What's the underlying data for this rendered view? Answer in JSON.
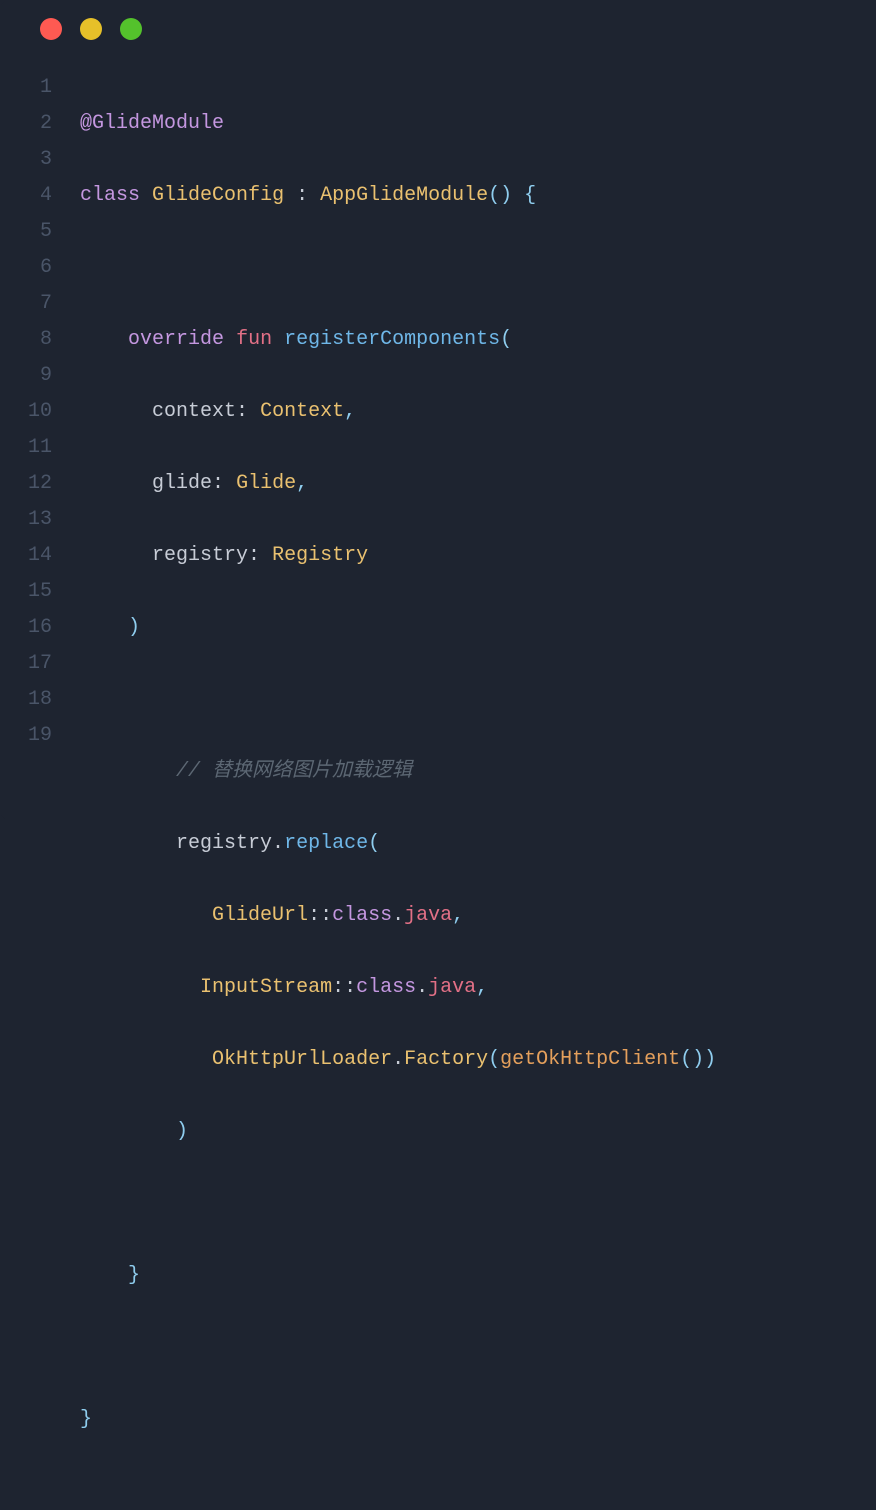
{
  "titleBar": {
    "buttons": [
      "close",
      "minimize",
      "maximize"
    ]
  },
  "lineNumbers": [
    "1",
    "2",
    "3",
    "4",
    "5",
    "6",
    "7",
    "8",
    "9",
    "10",
    "11",
    "12",
    "13",
    "14",
    "15",
    "16",
    "17",
    "18",
    "19"
  ],
  "code": {
    "l1_annotation": "@GlideModule",
    "l2_class": "class",
    "l2_name": "GlideConfig",
    "l2_colon": " : ",
    "l2_parent": "AppGlideModule",
    "l2_parens": "()",
    "l2_brace": " {",
    "l4_indent": "    ",
    "l4_override": "override",
    "l4_sp": " ",
    "l4_fun": "fun",
    "l4_sp2": " ",
    "l4_method": "registerComponents",
    "l4_open": "(",
    "l5_indent": "      ",
    "l5_param": "context",
    "l5_colon": ": ",
    "l5_type": "Context",
    "l5_comma": ",",
    "l6_indent": "      ",
    "l6_param": "glide",
    "l6_colon": ": ",
    "l6_type": "Glide",
    "l6_comma": ",",
    "l7_indent": "      ",
    "l7_param": "registry",
    "l7_colon": ": ",
    "l7_type": "Registry",
    "l8_indent": "    ",
    "l8_close": ")",
    "l10_indent": "        ",
    "l10_comment": "// 替换网络图片加载逻辑",
    "l11_indent": "        ",
    "l11_obj": "registry",
    "l11_dot": ".",
    "l11_method": "replace",
    "l11_open": "(",
    "l12_indent": "           ",
    "l12_cls": "GlideUrl",
    "l12_cc": "::",
    "l12_class": "class",
    "l12_dot": ".",
    "l12_java": "java",
    "l12_comma": ",",
    "l13_indent": "          ",
    "l13_cls": "InputStream",
    "l13_cc": "::",
    "l13_class": "class",
    "l13_dot": ".",
    "l13_java": "java",
    "l13_comma": ",",
    "l14_indent": "           ",
    "l14_cls": "OkHttpUrlLoader",
    "l14_dot": ".",
    "l14_factory": "Factory",
    "l14_open": "(",
    "l14_fn": "getOkHttpClient",
    "l14_call": "()",
    "l14_close": ")",
    "l15_indent": "        ",
    "l15_close": ")",
    "l17_indent": "    ",
    "l17_brace": "}",
    "l19_brace": "}"
  }
}
